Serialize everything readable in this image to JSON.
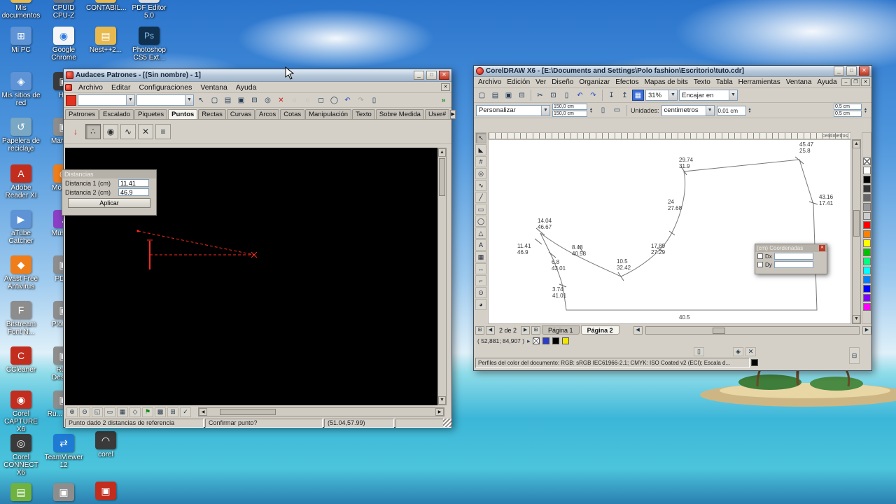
{
  "colors": {
    "titlebar": "#b4c6d8",
    "window_face": "#d4d0c8",
    "close_button": "#c23822",
    "pattern_red": "#ff2a1e",
    "canvas_black": "#000000"
  },
  "desktop": {
    "icons": [
      {
        "label": "Mis documentos",
        "glyph": "▤"
      },
      {
        "label": "Mi PC",
        "glyph": "⊞"
      },
      {
        "label": "Mis sitios de red",
        "glyph": "◈"
      },
      {
        "label": "Papelera de reciclaje",
        "glyph": "↺"
      },
      {
        "label": "Adobe Reader XI",
        "glyph": "A"
      },
      {
        "label": "aTube Catcher",
        "glyph": "▶"
      },
      {
        "label": "Avast Free Antivirus",
        "glyph": "◆"
      },
      {
        "label": "Bitstream Font N...",
        "glyph": "F"
      },
      {
        "label": "CCleaner",
        "glyph": "C"
      },
      {
        "label": "Corel CAPTURE X6",
        "glyph": "◉"
      },
      {
        "label": "Corel CONNECT X6",
        "glyph": "◎"
      },
      {
        "label": "",
        "glyph": "▤"
      },
      {
        "label": "CPUID CPU-Z",
        "glyph": "Z"
      },
      {
        "label": "Google Chrome",
        "glyph": "◉"
      },
      {
        "label": "HD",
        "glyph": "▣"
      },
      {
        "label": "Marke...",
        "glyph": "▣"
      },
      {
        "label": "Mozill...",
        "glyph": "◉"
      },
      {
        "label": "Music...",
        "glyph": "♪"
      },
      {
        "label": "PDI...",
        "glyph": "▣"
      },
      {
        "label": "Plotte...",
        "glyph": "▣"
      },
      {
        "label": "Ru... Desig...",
        "glyph": "▣"
      },
      {
        "label": "Ru... Vie...",
        "glyph": "▣"
      },
      {
        "label": "TeamViewer 12",
        "glyph": "⇄"
      },
      {
        "label": "",
        "glyph": "▣"
      },
      {
        "label": "CONTABIL...",
        "glyph": "▤"
      },
      {
        "label": "Nest++2...",
        "glyph": "▤"
      },
      {
        "label": "corel",
        "glyph": "◠"
      },
      {
        "label": "",
        "glyph": "▣"
      },
      {
        "label": "PDF Editor 5.0",
        "glyph": "PDF"
      },
      {
        "label": "Photoshop CS5 Ext...",
        "glyph": "Ps"
      }
    ]
  },
  "audaces": {
    "title": "Audaces Patrones - [(Sin nombre) - 1]",
    "menus": [
      "Archivo",
      "Editar",
      "Configuraciones",
      "Ventana",
      "Ayuda"
    ],
    "toolbar_icons": [
      {
        "name": "pointer",
        "glyph": "↖"
      },
      {
        "name": "new-document",
        "glyph": "▢"
      },
      {
        "name": "open",
        "glyph": "▤"
      },
      {
        "name": "save",
        "glyph": "▣"
      },
      {
        "name": "print",
        "glyph": "⊟"
      },
      {
        "name": "zoom",
        "glyph": "◎"
      },
      {
        "name": "delete",
        "glyph": "✕"
      },
      {
        "name": "tool-a",
        "glyph": "◌"
      },
      {
        "name": "tool-b",
        "glyph": "◌"
      },
      {
        "name": "marquee",
        "glyph": "◻"
      },
      {
        "name": "circle-tool",
        "glyph": "◯"
      },
      {
        "name": "undo",
        "glyph": "↶"
      },
      {
        "name": "redo",
        "glyph": "↷"
      },
      {
        "name": "sheet",
        "glyph": "▯"
      },
      {
        "name": "run",
        "glyph": "»"
      }
    ],
    "tabs": [
      "Patrones",
      "Escalado",
      "Piquetes",
      "Puntos",
      "Rectas",
      "Curvas",
      "Arcos",
      "Cotas",
      "Manipulación",
      "Texto",
      "Sobre Medida",
      "User#"
    ],
    "point_tools": [
      {
        "name": "point-by-distance",
        "glyph": "↓"
      },
      {
        "name": "point-grid",
        "glyph": "∴"
      },
      {
        "name": "point-circle",
        "glyph": "◉"
      },
      {
        "name": "point-curve",
        "glyph": "∿"
      },
      {
        "name": "point-delete",
        "glyph": "✕"
      },
      {
        "name": "point-precision",
        "glyph": "≡"
      }
    ],
    "distancias": {
      "title": "Distancias",
      "label1": "Distancia 1 (cm)",
      "value1": "11.41",
      "label2": "Distancia 2 (cm)",
      "value2": "46.9",
      "apply": "Aplicar"
    },
    "bottom_icons": [
      {
        "name": "zoom-in",
        "glyph": "⊕"
      },
      {
        "name": "zoom-out",
        "glyph": "⊖"
      },
      {
        "name": "zoom-fit",
        "glyph": "◱"
      },
      {
        "name": "zoom-page",
        "glyph": "▭"
      },
      {
        "name": "zoom-all",
        "glyph": "▦"
      },
      {
        "name": "pan",
        "glyph": "◇"
      },
      {
        "name": "flag",
        "glyph": "⚑"
      },
      {
        "name": "grid",
        "glyph": "▩"
      },
      {
        "name": "table",
        "glyph": "⊞"
      },
      {
        "name": "confirm",
        "glyph": "✓"
      }
    ],
    "status": {
      "message": "Punto dado 2 distancias de referencia",
      "prompt": "Confirmar punto?",
      "coords": "(51.04,57.99)"
    }
  },
  "corel": {
    "title": "CorelDRAW X6 - [E:\\Documents and Settings\\Polo fashion\\Escritorio\\tuto.cdr]",
    "menus": [
      "Archivo",
      "Edición",
      "Ver",
      "Diseño",
      "Organizar",
      "Efectos",
      "Mapas de bits",
      "Texto",
      "Tabla",
      "Herramientas",
      "Ventana",
      "Ayuda"
    ],
    "std_icons": [
      {
        "name": "new",
        "glyph": "▢"
      },
      {
        "name": "open",
        "glyph": "▤"
      },
      {
        "name": "save",
        "glyph": "▣"
      },
      {
        "name": "print",
        "glyph": "⊟"
      },
      {
        "name": "cut",
        "glyph": "✂"
      },
      {
        "name": "copy",
        "glyph": "⊡"
      },
      {
        "name": "paste",
        "glyph": "▯"
      },
      {
        "name": "undo",
        "glyph": "↶"
      },
      {
        "name": "redo",
        "glyph": "↷"
      },
      {
        "name": "import",
        "glyph": "↧"
      },
      {
        "name": "export",
        "glyph": "↥"
      }
    ],
    "zoom": "31%",
    "fit_label": "Encajar en",
    "property": {
      "preset": "Personalizar",
      "w": "150,0 cm",
      "h": "150,0 cm",
      "units_label": "Unidades:",
      "units": "centimetros",
      "nudge": "0,01 cm",
      "dupx": "0,5 cm",
      "dupy": "0,5 cm"
    },
    "ruler_units": "centimetros",
    "toolbox": [
      {
        "name": "pick",
        "glyph": "↖"
      },
      {
        "name": "shape",
        "glyph": "◣"
      },
      {
        "name": "crop",
        "glyph": "#"
      },
      {
        "name": "zoom",
        "glyph": "◎"
      },
      {
        "name": "freehand",
        "glyph": "∿"
      },
      {
        "name": "smart-draw",
        "glyph": "╱"
      },
      {
        "name": "rectangle",
        "glyph": "▭"
      },
      {
        "name": "ellipse",
        "glyph": "◯"
      },
      {
        "name": "polygon",
        "glyph": "△"
      },
      {
        "name": "text",
        "glyph": "A"
      },
      {
        "name": "table",
        "glyph": "▦"
      },
      {
        "name": "dimension",
        "glyph": "↔"
      },
      {
        "name": "connector",
        "glyph": "⌐"
      },
      {
        "name": "eyedropper",
        "glyph": "⊙"
      },
      {
        "name": "fill",
        "glyph": "◕"
      }
    ],
    "measurements": [
      "45.47\n25.8",
      "29.74\n31.9",
      "43.16\n17.41",
      "24\n27.68",
      "14.04\n46.67",
      "11.41\n46.9",
      "8.48\n40.58",
      "17.89\n27.29",
      "6.8\n43.01",
      "10.5\n32.42",
      "3.74\n41.01",
      "40.5"
    ],
    "coord_panel": {
      "title": "(cm) Coordenadas",
      "dx": "Dx",
      "dy": "Dy"
    },
    "pages": {
      "position": "2 de 2",
      "tabs": [
        "Página 1",
        "Página 2"
      ],
      "icons": [
        {
          "name": "object-manager",
          "glyph": "⊞"
        },
        {
          "name": "prev-page",
          "glyph": "◀"
        },
        {
          "name": "next-page",
          "glyph": "▶"
        },
        {
          "name": "add-page",
          "glyph": "⊞"
        }
      ]
    },
    "palette": [
      "none",
      "#ffffff",
      "#000000",
      "#333333",
      "#666666",
      "#999999",
      "#cccccc",
      "#ff0000",
      "#ff8000",
      "#ffff00",
      "#00c000",
      "#00ff80",
      "#00ffff",
      "#0080ff",
      "#0000ff",
      "#8000ff",
      "#ff00ff"
    ],
    "status": {
      "coords": "( 52,881; 84,907 )",
      "swatches": [
        "#2a3cc8",
        "#000000",
        "#f0e800"
      ],
      "profile": "Perfiles del color del documento: RGB: sRGB IEC61966-2.1; CMYK: ISO Coated v2 (ECI); Escala d..."
    }
  }
}
